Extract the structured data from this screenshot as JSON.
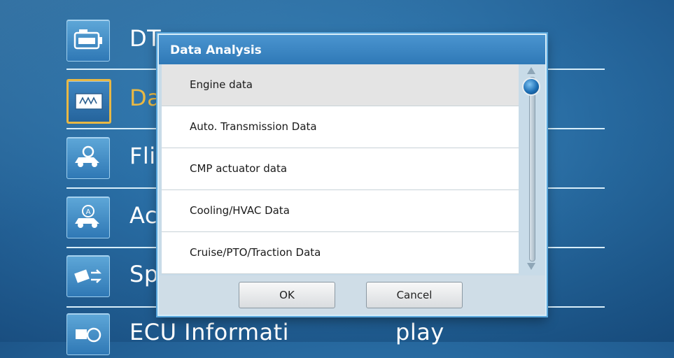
{
  "menu": {
    "items": [
      {
        "label": "DT",
        "icon": "engine-check-icon",
        "selected": false
      },
      {
        "label": "Da",
        "icon": "waveform-icon",
        "selected": true
      },
      {
        "label": "Fli",
        "icon": "car-search-icon",
        "selected": false
      },
      {
        "label": "Ac",
        "icon": "car-actuator-icon",
        "selected": false
      },
      {
        "label": "Sp",
        "icon": "chip-transfer-icon",
        "selected": false
      },
      {
        "label": "ECU Informati",
        "label_tail": "play",
        "icon": "ecu-info-icon",
        "selected": false
      }
    ]
  },
  "dialog": {
    "title": "Data Analysis",
    "list": [
      "Engine data",
      "Auto. Transmission Data",
      "CMP actuator data",
      "Cooling/HVAC Data",
      "Cruise/PTO/Traction Data"
    ],
    "selected_index": 0,
    "ok_label": "OK",
    "cancel_label": "Cancel"
  },
  "colors": {
    "accent": "#e8b844",
    "titlebar": "#3a86c4",
    "background": "#2a6fa6"
  }
}
